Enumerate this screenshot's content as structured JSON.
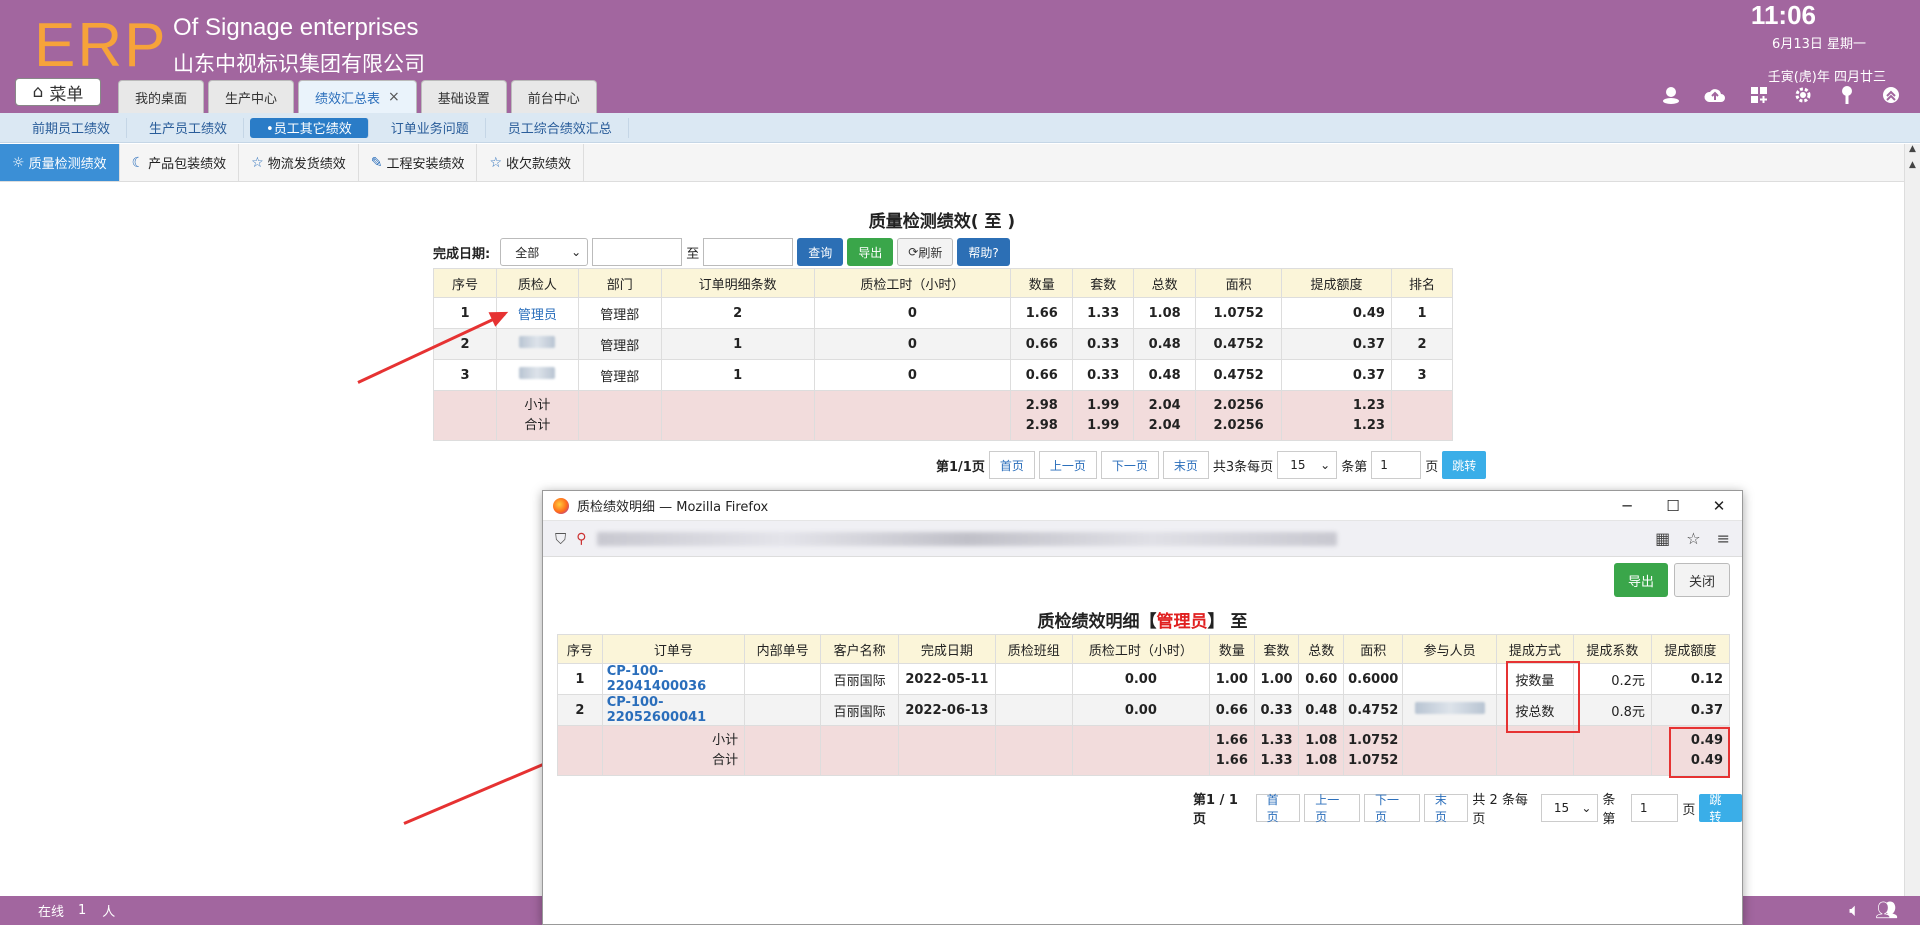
{
  "header": {
    "logo": "ERP",
    "company_en": "Of Signage enterprises",
    "company_cn": "山东中视标识集团有限公司",
    "time": "11:06",
    "date": "6月13日 星期一",
    "lunar": "壬寅(虎)年 四月廿三",
    "menu_label": "菜单",
    "tabs": [
      {
        "label": "我的桌面"
      },
      {
        "label": "生产中心"
      },
      {
        "label": "绩效汇总表"
      },
      {
        "label": "基础设置"
      },
      {
        "label": "前台中心"
      }
    ],
    "close_glyph": "×"
  },
  "subnav": {
    "items": [
      {
        "label": "前期员工绩效"
      },
      {
        "label": "生产员工绩效"
      },
      {
        "label": "•员工其它绩效"
      },
      {
        "label": "订单业务问题"
      },
      {
        "label": "员工综合绩效汇总"
      }
    ]
  },
  "thirdnav": {
    "items": [
      {
        "label": "质量检测绩效",
        "icon": "☼"
      },
      {
        "label": "产品包装绩效",
        "icon": "☾"
      },
      {
        "label": "物流发货绩效",
        "icon": "☆"
      },
      {
        "label": "工程安装绩效",
        "icon": "✎"
      },
      {
        "label": "收欠款绩效",
        "icon": "☆"
      }
    ]
  },
  "main": {
    "title": "质量检测绩效( 至 )",
    "filter_label": "完成日期:",
    "filter_select": "全部",
    "range_sep": "至",
    "btn_query": "查询",
    "btn_export": "导出",
    "btn_refresh": "刷新",
    "btn_help": "帮助?",
    "columns": [
      "序号",
      "质检人",
      "部门",
      "订单明细条数",
      "质检工时（小时）",
      "数量",
      "套数",
      "总数",
      "面积",
      "提成额度",
      "排名"
    ],
    "rows": [
      {
        "no": "1",
        "person": "管理员",
        "dept": "管理部",
        "count": "2",
        "hours": "0",
        "qty": "1.66",
        "sets": "1.33",
        "total": "1.08",
        "area": "1.0752",
        "commission": "0.49",
        "rank": "1"
      },
      {
        "no": "2",
        "person": "",
        "dept": "管理部",
        "count": "1",
        "hours": "0",
        "qty": "0.66",
        "sets": "0.33",
        "total": "0.48",
        "area": "0.4752",
        "commission": "0.37",
        "rank": "2"
      },
      {
        "no": "3",
        "person": "",
        "dept": "管理部",
        "count": "1",
        "hours": "0",
        "qty": "0.66",
        "sets": "0.33",
        "total": "0.48",
        "area": "0.4752",
        "commission": "0.37",
        "rank": "3"
      }
    ],
    "subtotal_label": "小计",
    "total_label": "合计",
    "subtotal": {
      "qty": "2.98",
      "sets": "1.99",
      "total": "2.04",
      "area": "2.0256",
      "commission": "1.23"
    },
    "grand": {
      "qty": "2.98",
      "sets": "1.99",
      "total": "2.04",
      "area": "2.0256",
      "commission": "1.23"
    },
    "pager": {
      "page_info": "第1/1页",
      "first": "首页",
      "prev": "上一页",
      "next": "下一页",
      "last": "末页",
      "total": "共3条每页",
      "per_page": "15",
      "page_label": "条第",
      "page_value": "1",
      "page_suffix": "页",
      "jump": "跳转"
    }
  },
  "popup": {
    "window_title": "质检绩效明细 — Mozilla Firefox",
    "btn_export": "导出",
    "btn_close": "关闭",
    "title_prefix": "质检绩效明细【",
    "title_name": "管理员",
    "title_suffix": "】 至",
    "columns": [
      "序号",
      "订单号",
      "内部单号",
      "客户名称",
      "完成日期",
      "质检班组",
      "质检工时（小时）",
      "数量",
      "套数",
      "总数",
      "面积",
      "参与人员",
      "提成方式",
      "提成系数",
      "提成额度"
    ],
    "rows": [
      {
        "no": "1",
        "order": "CP-100-22041400036",
        "inner": "",
        "customer": "百丽国际",
        "date": "2022-05-11",
        "team": "",
        "hours": "0.00",
        "qty": "1.00",
        "sets": "1.00",
        "total": "0.60",
        "area": "0.6000",
        "people": "",
        "method": "按数量",
        "coef": "0.2元",
        "commission": "0.12"
      },
      {
        "no": "2",
        "order": "CP-100-22052600041",
        "inner": "",
        "customer": "百丽国际",
        "date": "2022-06-13",
        "team": "",
        "hours": "0.00",
        "qty": "0.66",
        "sets": "0.33",
        "total": "0.48",
        "area": "0.4752",
        "people": "",
        "method": "按总数",
        "coef": "0.8元",
        "commission": "0.37"
      }
    ],
    "subtotal_label": "小计",
    "total_label": "合计",
    "subtotal": {
      "qty": "1.66",
      "sets": "1.33",
      "total": "1.08",
      "area": "1.0752",
      "commission": "0.49"
    },
    "grand": {
      "qty": "1.66",
      "sets": "1.33",
      "total": "1.08",
      "area": "1.0752",
      "commission": "0.49"
    },
    "pager": {
      "page_info": "第1 / 1 页",
      "first": "首页",
      "prev": "上一页",
      "next": "下一页",
      "last": "末页",
      "total": "共 2 条每页",
      "per_page": "15",
      "page_label": "条第",
      "page_value": "1",
      "page_suffix": "页",
      "jump": "跳转"
    }
  },
  "footer": {
    "online_label": "在线",
    "online_count": "1",
    "online_unit": "人"
  },
  "colors": {
    "header_bg": "#a2669f",
    "logo": "#f6a33a",
    "accent_blue": "#2c6fb5",
    "export_green": "#3aa64a",
    "annotation_red": "#e63232"
  }
}
